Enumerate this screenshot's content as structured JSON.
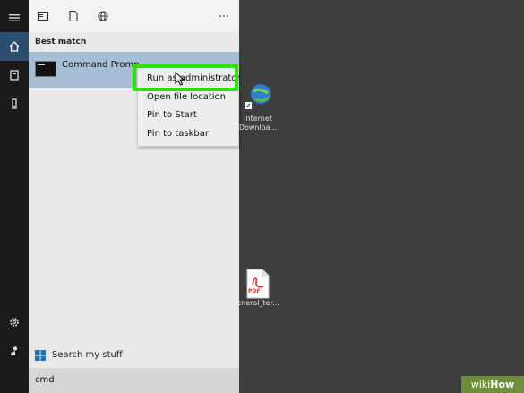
{
  "start_menu": {
    "best_match_heading": "Best match",
    "result_name": "Command Promp",
    "search_my_stuff": "Search my stuff",
    "search_value": "cmd"
  },
  "context_menu": {
    "items": [
      {
        "label": "Run as administrator"
      },
      {
        "label": "Open file location"
      },
      {
        "label": "Pin to Start"
      },
      {
        "label": "Pin to taskbar"
      }
    ]
  },
  "desktop": {
    "icons": [
      {
        "label_line1": "Internet",
        "label_line2": "Downloa..."
      },
      {
        "label_line1": "eneral_ter...",
        "label_line2": ""
      }
    ],
    "pdf_badge": "PDF"
  },
  "watermark": {
    "prefix": "wiki",
    "suffix": "How"
  },
  "colors": {
    "highlight": "#2fe000",
    "selected_row": "#a7bfd6",
    "rail": "#1a1a1a",
    "desktop": "#3e3e3e"
  }
}
